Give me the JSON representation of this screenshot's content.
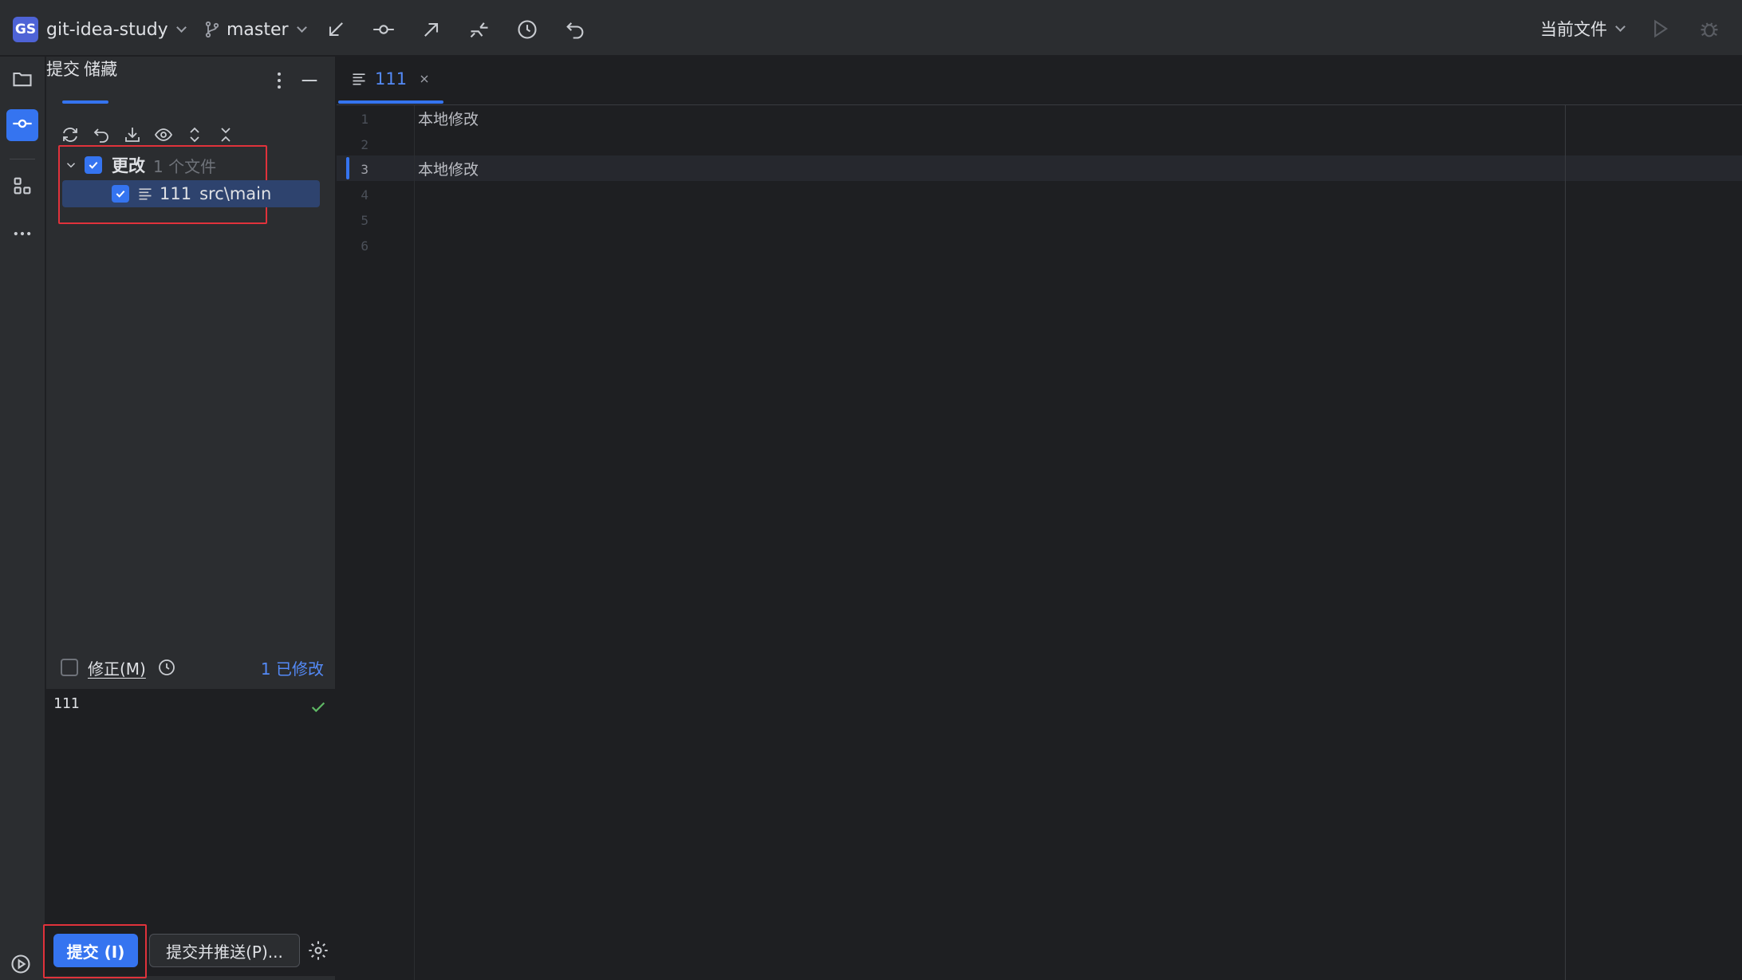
{
  "toolbar": {
    "project_badge": "GS",
    "project_name": "git-idea-study",
    "branch": "master",
    "current_file": "当前文件",
    "icons": [
      "update-project-icon",
      "commit-icon",
      "push-icon",
      "pull-requests-icon",
      "history-icon",
      "rollback-icon",
      "run-icon",
      "debug-icon"
    ]
  },
  "rail": {
    "icons": [
      "folder-icon",
      "commit-tool-icon",
      "structure-icon",
      "more-icon"
    ]
  },
  "commit_panel": {
    "tabs": [
      "提交",
      "储藏"
    ],
    "tool_icons": [
      "refresh-icon",
      "rollback-icon",
      "shelve-icon",
      "show-diff-icon",
      "expand-all-icon",
      "collapse-all-icon"
    ],
    "group": {
      "label": "更改",
      "count": "1 个文件"
    },
    "files": [
      {
        "name": "111",
        "path": "src\\main"
      }
    ],
    "amend_label": "修正(M)",
    "modified_count": "1 已修改",
    "commit_message": "111",
    "commit_button": "提交 (I)",
    "commit_push_button": "提交并推送(P)..."
  },
  "editor": {
    "tab_name": "111",
    "lines": [
      {
        "n": "1",
        "text": "本地修改"
      },
      {
        "n": "2",
        "text": ""
      },
      {
        "n": "3",
        "text": "本地修改"
      },
      {
        "n": "4",
        "text": ""
      },
      {
        "n": "5",
        "text": ""
      },
      {
        "n": "6",
        "text": ""
      }
    ]
  },
  "colors": {
    "accent": "#3574f0",
    "highlight_box": "#e0323b",
    "background": "#1e1f22",
    "panel": "#2b2d30"
  }
}
